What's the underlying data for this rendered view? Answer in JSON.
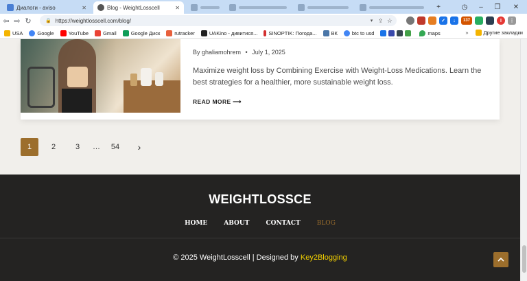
{
  "browser": {
    "tabs": [
      {
        "title": "Диалоги - aviso",
        "active": false
      },
      {
        "title": "Blog - WeightLosscell",
        "active": true
      }
    ],
    "url": "https://weightlosscell.com/blog/",
    "bookmarks": [
      "USA",
      "Google",
      "YouTube",
      "Gmail",
      "Google Диск",
      "rutracker",
      "UAKino - дивитися...",
      "SINOPTIK: Погода...",
      "ВК",
      "btc to usd",
      "maps"
    ],
    "other_bookmarks": "Другие закладки",
    "extension_badge": "137"
  },
  "post": {
    "author": "By ghaliamohrem",
    "separator": "•",
    "date": "July 1, 2025",
    "excerpt": "Maximize weight loss by Combining Exercise with Weight-Loss Medications. Learn the best strategies for a healthier, more sustainable weight loss.",
    "read_more": "READ MORE ⟶"
  },
  "pagination": {
    "pages": [
      "1",
      "2",
      "3",
      "…",
      "54"
    ],
    "current": "1",
    "next": "›"
  },
  "footer": {
    "site_title": "WEIGHTLOSSCE",
    "nav": [
      "HOME",
      "ABOUT",
      "CONTACT",
      "BLOG"
    ],
    "active_nav": "BLOG",
    "copyright_prefix": "© 2025 WeightLosscell | Designed by ",
    "copyright_link": "Key2Blogging",
    "to_top_icon": "chevron-up-icon"
  },
  "colors": {
    "accent": "#9c6e2c",
    "footer_bg": "#242322",
    "link_yellow": "#f5d200",
    "page_bg": "#f1efeb"
  }
}
